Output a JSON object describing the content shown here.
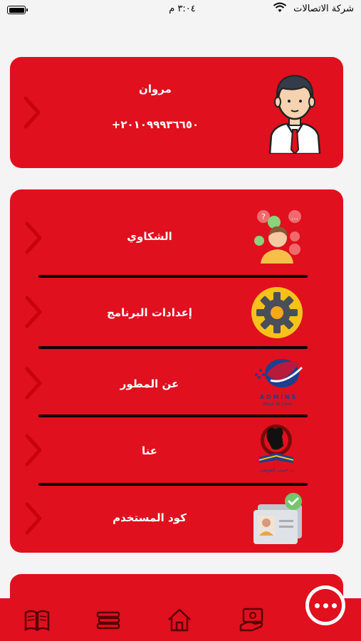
{
  "status_bar": {
    "carrier": "شركة الاتصالات",
    "time": "٣:٠٤ م",
    "battery_level": 1.0
  },
  "profile": {
    "name": "مروان",
    "phone": "+٢٠١٠٩٩٩٣٦٦٥٠",
    "avatar_icon": "user-avatar-icon"
  },
  "menu": {
    "items": [
      {
        "label": "الشكاوي",
        "icon": "complaints-icon"
      },
      {
        "label": "إعدادات البرنامج",
        "icon": "gear-icon"
      },
      {
        "label": "عن المطور",
        "icon": "developer-logo-icon"
      },
      {
        "label": "عنا",
        "icon": "about-logo-icon"
      },
      {
        "label": "كود المستخدم",
        "icon": "user-code-icon"
      }
    ],
    "developer_logo_text": "A D M I N S",
    "developer_logo_tagline": "Ways To Clear",
    "about_logo_text": "د. حبيب العوضي"
  },
  "bottom_nav": {
    "items": [
      {
        "icon": "book-icon"
      },
      {
        "icon": "stack-icon"
      },
      {
        "icon": "home-icon"
      },
      {
        "icon": "money-icon"
      }
    ],
    "fab_icon": "more-icon"
  },
  "colors": {
    "primary": "#e0101e",
    "background": "#f4f4f4"
  }
}
